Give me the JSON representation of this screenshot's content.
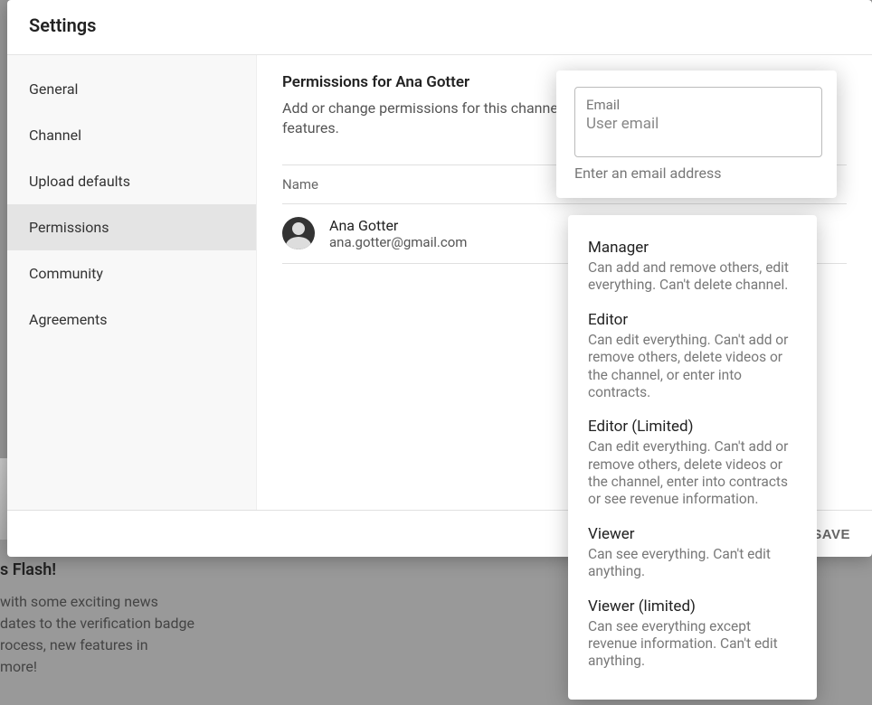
{
  "dialog": {
    "title": "Settings"
  },
  "sidebar": {
    "items": [
      {
        "label": "General"
      },
      {
        "label": "Channel"
      },
      {
        "label": "Upload defaults"
      },
      {
        "label": "Permissions"
      },
      {
        "label": "Community"
      },
      {
        "label": "Agreements"
      }
    ]
  },
  "main": {
    "title": "Permissions for Ana Gotter",
    "description": "Add or change permissions for this channel. Permissions won't apply to some channel features.",
    "name_column": "Name",
    "user": {
      "name": "Ana Gotter",
      "email": "ana.gotter@gmail.com"
    }
  },
  "footer": {
    "save": "SAVE"
  },
  "email_popover": {
    "label": "Email",
    "placeholder": "User email",
    "hint": "Enter an email address"
  },
  "roles": [
    {
      "name": "Manager",
      "desc": "Can add and remove others, edit everything. Can't delete channel."
    },
    {
      "name": "Editor",
      "desc": "Can edit everything. Can't add or remove others, delete videos or the channel, or enter into contracts."
    },
    {
      "name": "Editor (Limited)",
      "desc": "Can edit everything. Can't add or remove others, delete videos or the channel, enter into contracts or see revenue information."
    },
    {
      "name": "Viewer",
      "desc": "Can see everything. Can't edit anything."
    },
    {
      "name": "Viewer (limited)",
      "desc": "Can see everything except revenue information. Can't edit anything."
    }
  ],
  "background": {
    "title": "s Flash!",
    "line1": "with some exciting news",
    "line2": "dates to the verification badge",
    "line3": "rocess, new features in",
    "line4": "more!"
  }
}
